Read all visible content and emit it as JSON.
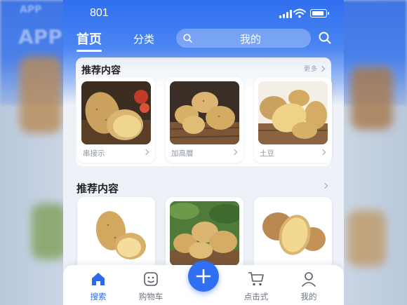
{
  "background": {
    "app_title": "APP"
  },
  "status_bar": {
    "time": "801"
  },
  "top_nav": {
    "tabs": [
      {
        "label": "首页"
      },
      {
        "label": "分类"
      }
    ],
    "search": {
      "label": "我的"
    }
  },
  "section1": {
    "title": "推荐内容",
    "more_label": "更多",
    "items": [
      {
        "label": "串接示"
      },
      {
        "label": "加高層"
      },
      {
        "label": "土豆"
      }
    ]
  },
  "section2": {
    "title": "推荐内容"
  },
  "tab_bar": {
    "items": [
      {
        "label": "搜索"
      },
      {
        "label": "购物车"
      },
      {
        "label": "点击式"
      },
      {
        "label": "我的"
      }
    ]
  },
  "colors": {
    "primary": "#2f6ff0",
    "potato": "#d8b16a",
    "wood": "#6b4a2e"
  },
  "icons": [
    "search-icon",
    "chevron-right-icon",
    "home-icon",
    "cart-icon",
    "plus-icon",
    "user-icon"
  ]
}
